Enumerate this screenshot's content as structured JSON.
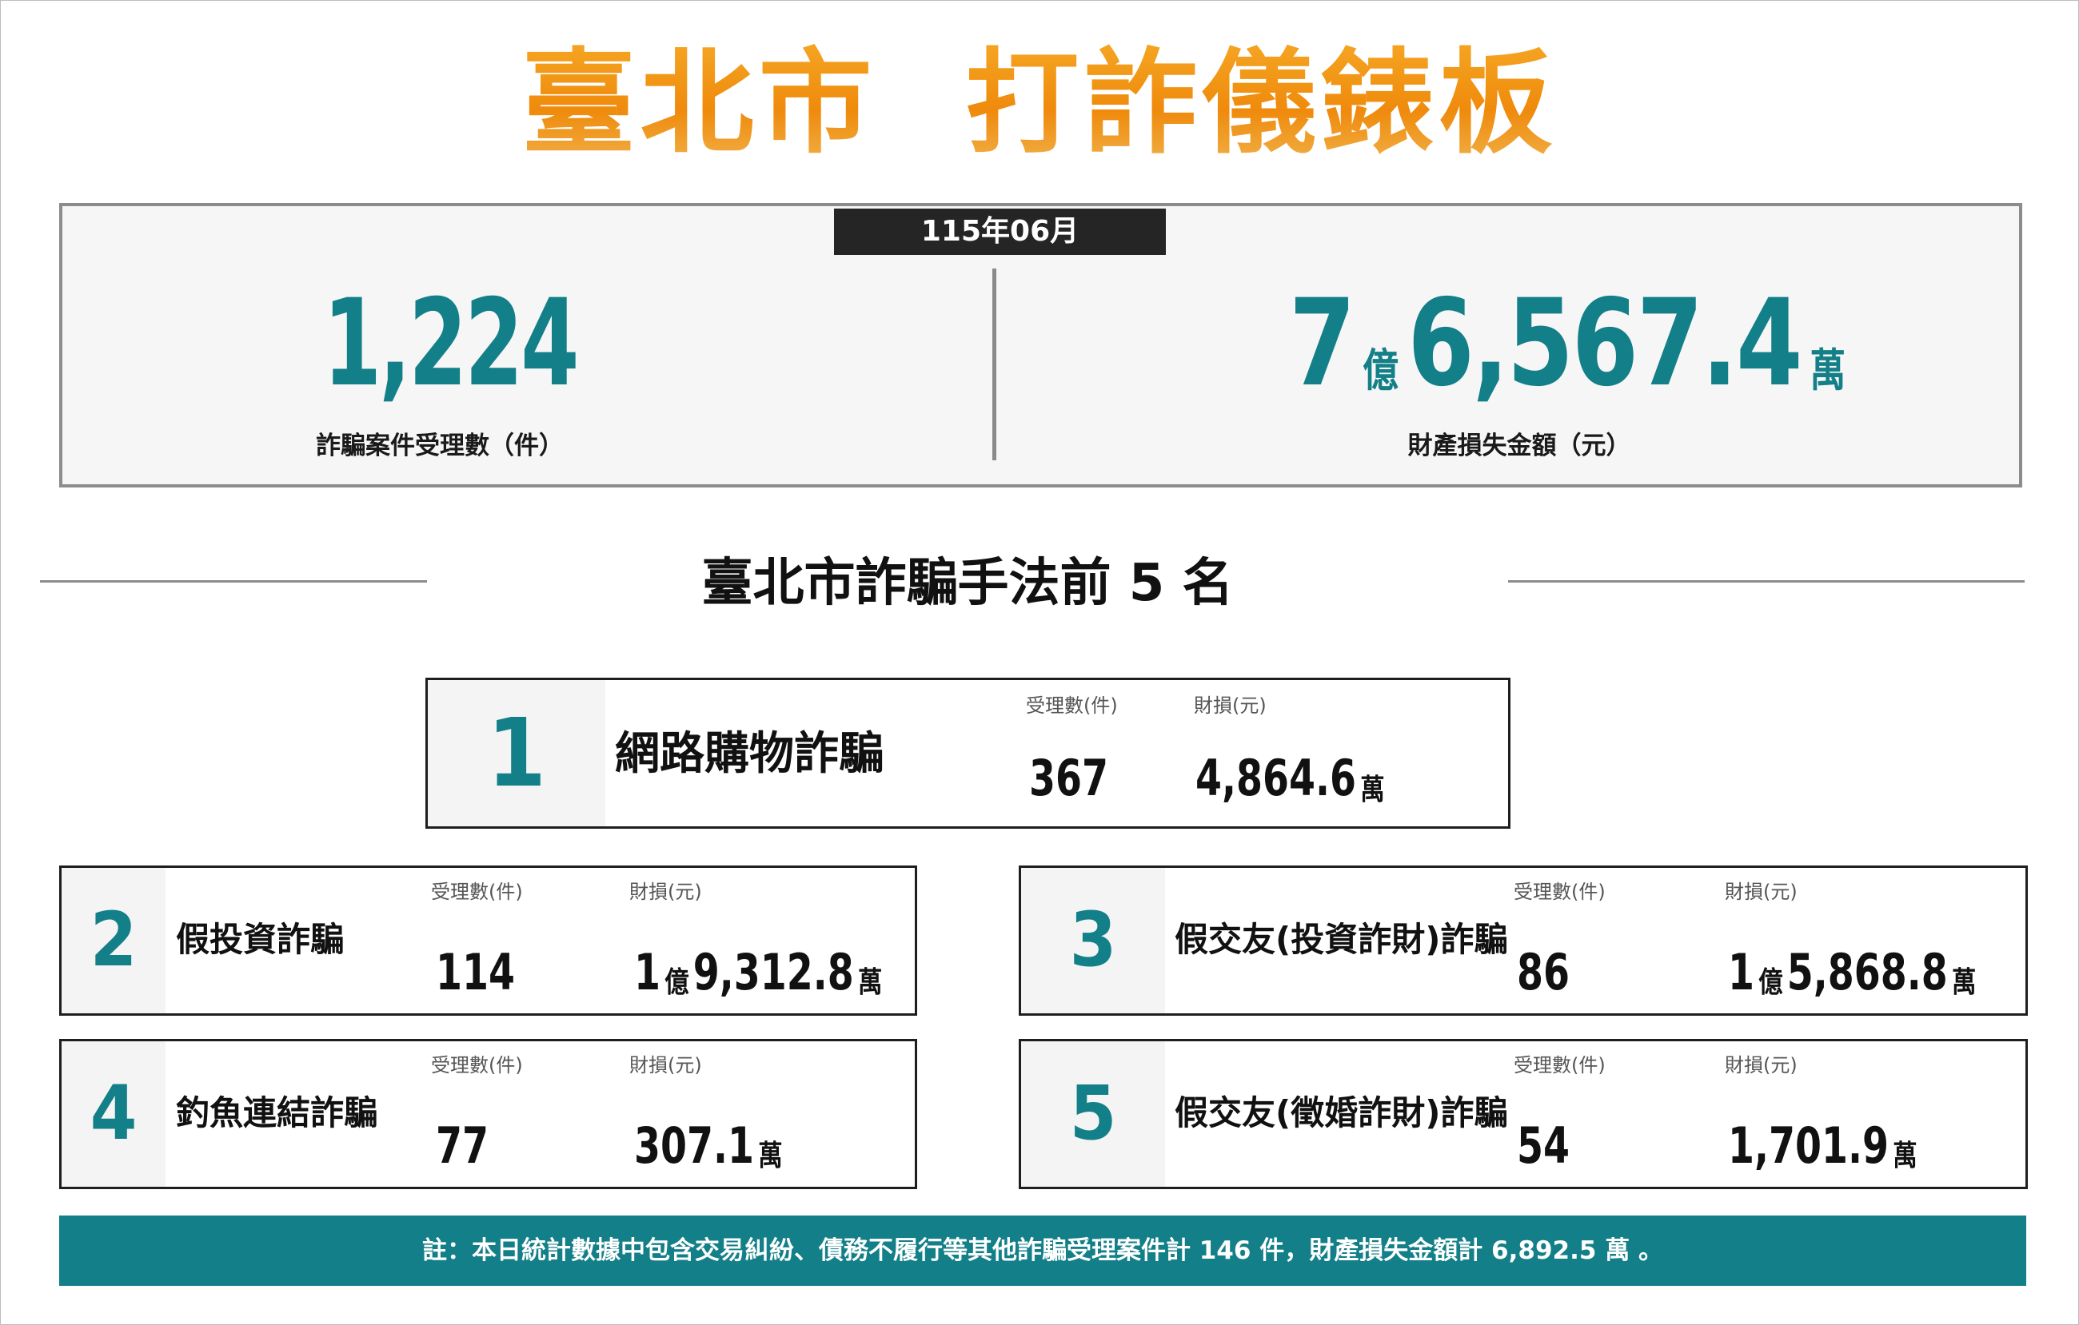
{
  "header": {
    "title": "臺北市  打詐儀錶板"
  },
  "summary": {
    "month": "115年06月",
    "cases_total": "1,224",
    "cases_caption": "詐騙案件受理數（件）",
    "loss_yi": "7",
    "loss_yi_unit": "億",
    "loss_wan": "6,567.4",
    "loss_wan_unit": "萬",
    "loss_caption": "財產損失金額（元）"
  },
  "section": {
    "title": "臺北市詐騙手法前 5 名"
  },
  "labels": {
    "cases": "受理數(件)",
    "loss": "財損(元)"
  },
  "ranks": [
    {
      "rank": "1",
      "name": "網路購物詐騙",
      "cases": "367",
      "loss_yi": "",
      "loss_yi_unit": "",
      "loss_wan": "4,864.6",
      "loss_wan_unit": "萬"
    },
    {
      "rank": "2",
      "name": "假投資詐騙",
      "cases": "114",
      "loss_yi": "1",
      "loss_yi_unit": "億",
      "loss_wan": "9,312.8",
      "loss_wan_unit": "萬"
    },
    {
      "rank": "3",
      "name": "假交友(投資詐財)詐騙",
      "cases": "86",
      "loss_yi": "1",
      "loss_yi_unit": "億",
      "loss_wan": "5,868.8",
      "loss_wan_unit": "萬"
    },
    {
      "rank": "4",
      "name": "釣魚連結詐騙",
      "cases": "77",
      "loss_yi": "",
      "loss_yi_unit": "",
      "loss_wan": "307.1",
      "loss_wan_unit": "萬"
    },
    {
      "rank": "5",
      "name": "假交友(徵婚詐財)詐騙",
      "cases": "54",
      "loss_yi": "",
      "loss_yi_unit": "",
      "loss_wan": "1,701.9",
      "loss_wan_unit": "萬"
    }
  ],
  "footer": {
    "note": "註：本日統計數據中包含交易糾紛、債務不履行等其他詐騙受理案件計 146 件，財產損失金額計 6,892.5 萬 。"
  },
  "colors": {
    "accent_teal": "#137f88",
    "title_orange": "#ef8a0c",
    "month_tab_bg": "#252525"
  }
}
